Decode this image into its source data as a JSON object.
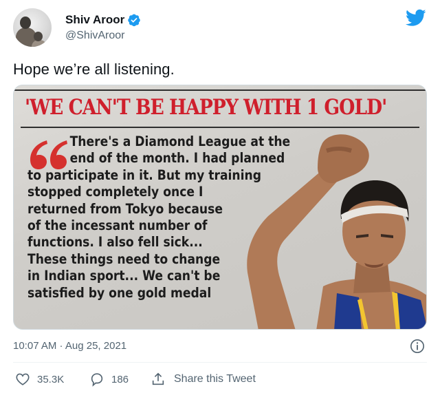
{
  "user": {
    "display_name": "Shiv Aroor",
    "handle": "@ShivAroor"
  },
  "tweet": {
    "text": "Hope we’re all listening."
  },
  "clipping": {
    "headline": "'WE CAN'T BE HAPPY WITH 1 GOLD'",
    "quote_lines": [
      "There's a Diamond League at the",
      "end of the month. I had planned",
      "to participate in it. But my training",
      "stopped completely once I",
      "returned from Tokyo because",
      "of the incessant number of",
      "functions. I also fell sick...",
      "These things need to change",
      "in Indian sport... We can't be",
      "satisfied by one gold medal"
    ]
  },
  "meta": {
    "timestamp": "10:07 AM · Aug 25, 2021"
  },
  "actions": {
    "likes": "35.3K",
    "replies": "186",
    "share_label": "Share this Tweet"
  },
  "icons": {
    "verified": "verified-badge-icon",
    "brand": "twitter-bird-icon",
    "info": "info-icon",
    "like": "heart-icon",
    "reply": "reply-bubble-icon",
    "share": "share-icon"
  },
  "colors": {
    "twitter_blue": "#1d9bf0",
    "headline_red": "#cf1f2c",
    "secondary_text": "#536471"
  }
}
